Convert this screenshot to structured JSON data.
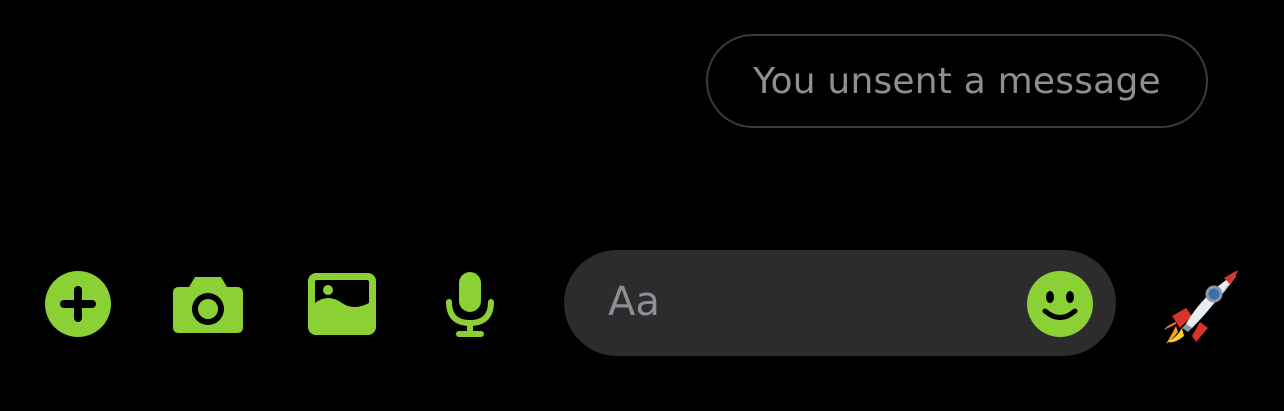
{
  "thread": {
    "unsent_notice": "You unsent a message"
  },
  "composer": {
    "placeholder": "Aa",
    "icons": {
      "more": "plus-circle-icon",
      "camera": "camera-icon",
      "gallery": "photo-icon",
      "voice": "microphone-icon",
      "emoji": "smiley-icon",
      "quick_reaction": "rocket-emoji-icon"
    }
  },
  "colors": {
    "accent": "#8bd135",
    "background": "#000000",
    "field": "#2c2c2e",
    "muted_text": "#8e8e93",
    "bubble_border": "#3a3a3c"
  }
}
